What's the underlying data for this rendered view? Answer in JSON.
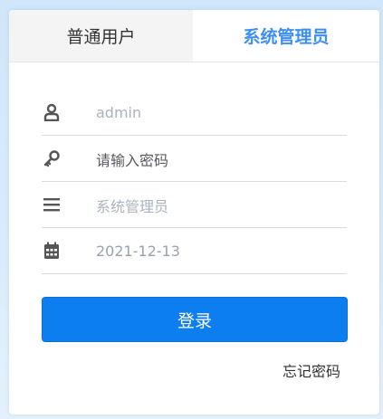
{
  "tabs": [
    {
      "label": "普通用户",
      "active": false
    },
    {
      "label": "系统管理员",
      "active": true
    }
  ],
  "form": {
    "username": {
      "value": "admin",
      "icon": "user-icon"
    },
    "password": {
      "placeholder": "请输入密码",
      "icon": "key-icon"
    },
    "role": {
      "value": "系统管理员",
      "icon": "menu-list-icon"
    },
    "date": {
      "value": "2021-12-13",
      "icon": "calendar-icon"
    }
  },
  "login_label": "登录",
  "forgot_label": "忘记密码",
  "colors": {
    "accent": "#3d8ef5",
    "button": "#0c7ef0",
    "icon": "#555555"
  }
}
